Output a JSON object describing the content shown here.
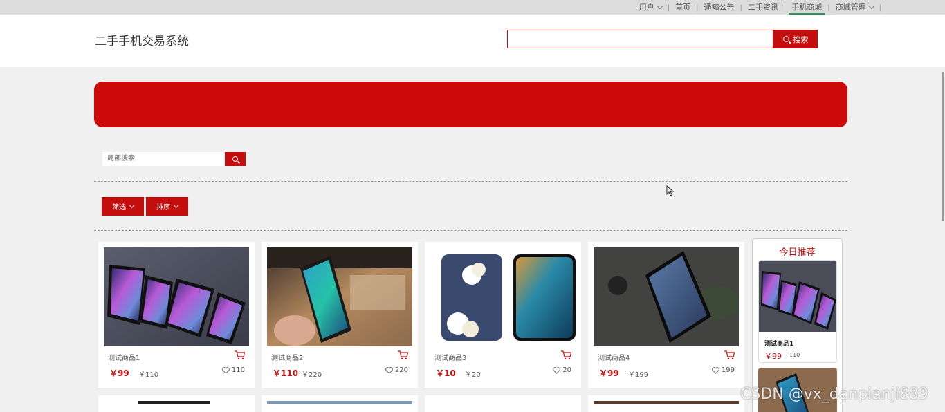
{
  "topnav": {
    "user": "用户",
    "home": "首页",
    "notice": "通知公告",
    "news": "二手资讯",
    "mall": "手机商城",
    "manage": "商城管理"
  },
  "header": {
    "logo": "二手手机交易系统",
    "search_placeholder": "",
    "search_button": "搜索"
  },
  "local_search": {
    "placeholder": "局部搜索"
  },
  "filters": {
    "filter_label": "筛选",
    "sort_label": "排序"
  },
  "products": [
    {
      "name": "测试商品1",
      "price": "￥99",
      "old_price": "￥110",
      "likes": "110"
    },
    {
      "name": "测试商品2",
      "price": "￥110",
      "old_price": "￥220",
      "likes": "220"
    },
    {
      "name": "测试商品3",
      "price": "￥10",
      "old_price": "￥20",
      "likes": "20"
    },
    {
      "name": "测试商品4",
      "price": "￥99",
      "old_price": "￥199",
      "likes": "199"
    }
  ],
  "recommend": {
    "title": "今日推荐",
    "item": {
      "name": "测试商品1",
      "price": "￥99",
      "old_price": "110"
    }
  },
  "watermark": "CSDN @vx_danpianji889",
  "colors": {
    "accent": "#c40d0d",
    "nav_active": "#3b8a5a"
  }
}
